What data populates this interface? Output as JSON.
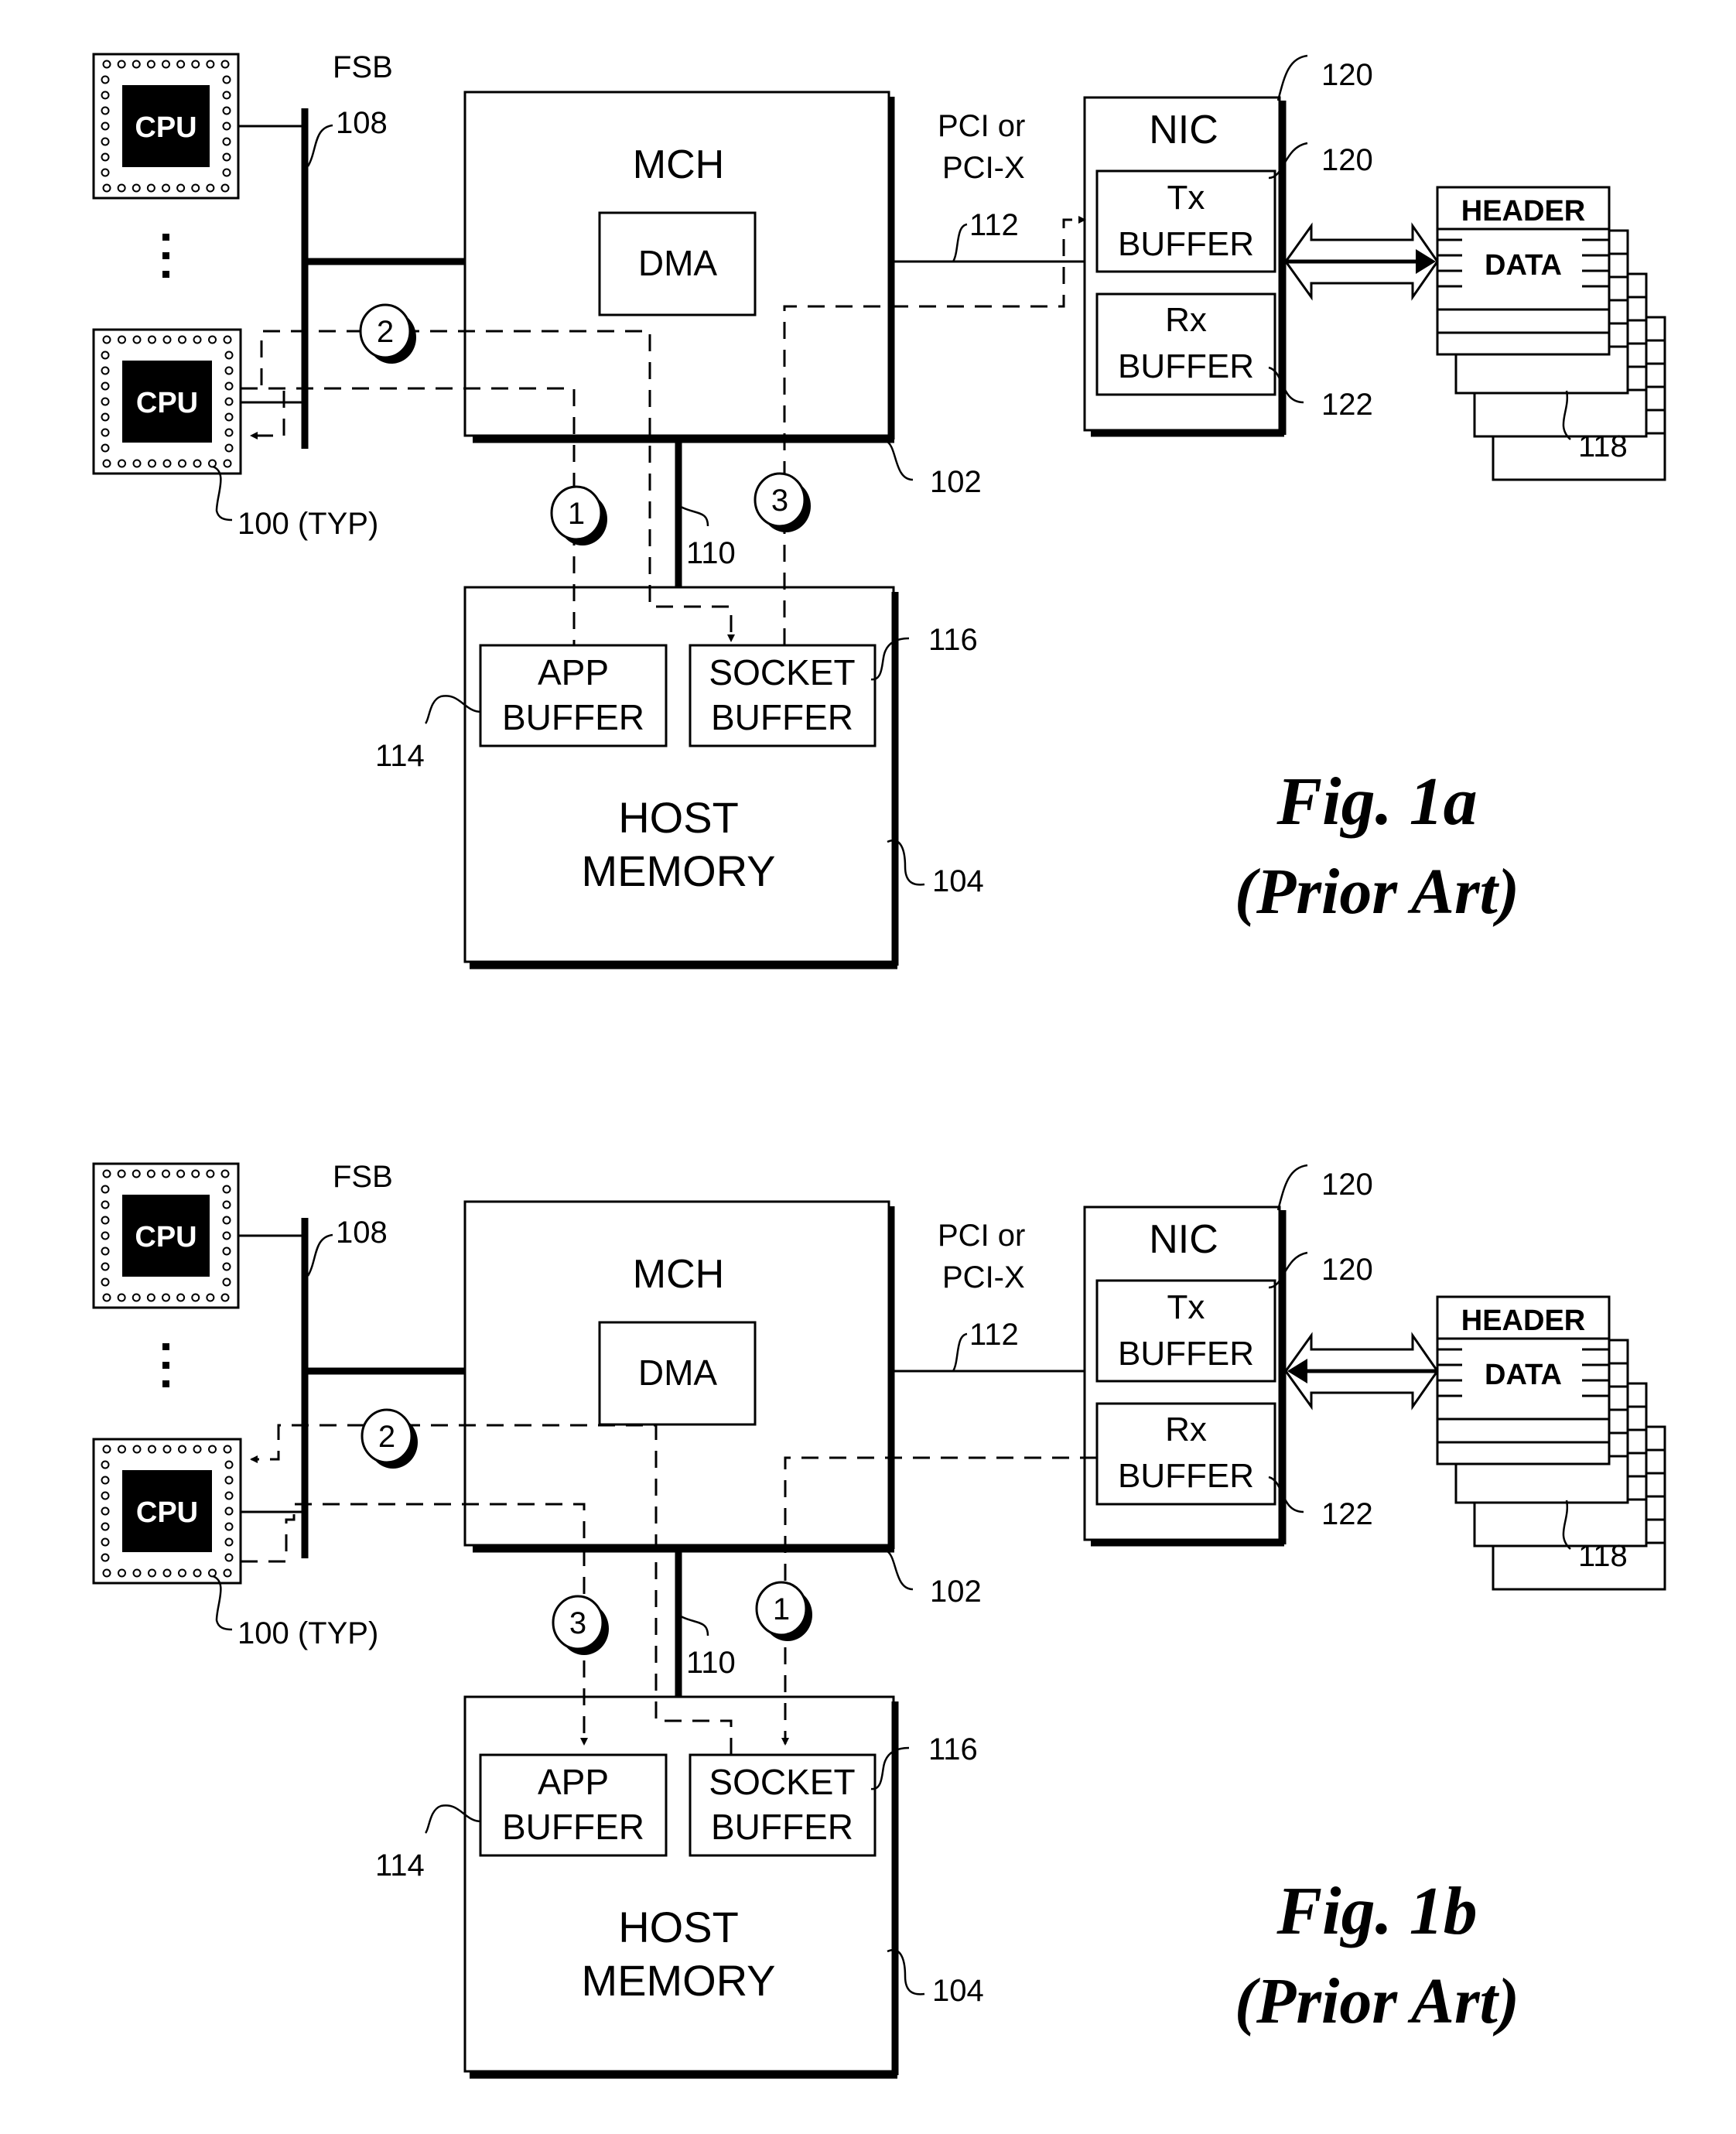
{
  "figures": [
    {
      "id": "fig-1a",
      "caption": "Fig. 1a",
      "subcaption": "(Prior Art)",
      "components": {
        "cpu_label": "CPU",
        "fsb_label": "FSB",
        "mch_label": "MCH",
        "dma_label": "DMA",
        "pci_label_line1": "PCI or",
        "pci_label_line2": "PCI-X",
        "nic_label": "NIC",
        "tx_line1": "Tx",
        "tx_line2": "BUFFER",
        "rx_line1": "Rx",
        "rx_line2": "BUFFER",
        "host_line1": "HOST",
        "host_line2": "MEMORY",
        "app_line1": "APP",
        "app_line2": "BUFFER",
        "socket_line1": "SOCKET",
        "socket_line2": "BUFFER",
        "packet_header": "HEADER",
        "packet_data": "DATA"
      },
      "refs": {
        "fsb": "108",
        "cpu": "100 (TYP)",
        "mch": "102",
        "mem_bus": "110",
        "pci_bus": "112",
        "host_memory": "104",
        "app_buffer": "114",
        "socket_buffer": "116",
        "packets": "118",
        "nic": "120",
        "tx_buffer": "120",
        "rx_buffer": "122"
      },
      "steps": [
        "1",
        "2",
        "3"
      ],
      "flow": "transmit: app buffer -> CPU -> socket buffer -> Tx buffer"
    },
    {
      "id": "fig-1b",
      "caption": "Fig. 1b",
      "subcaption": "(Prior Art)",
      "components": {
        "cpu_label": "CPU",
        "fsb_label": "FSB",
        "mch_label": "MCH",
        "dma_label": "DMA",
        "pci_label_line1": "PCI or",
        "pci_label_line2": "PCI-X",
        "nic_label": "NIC",
        "tx_line1": "Tx",
        "tx_line2": "BUFFER",
        "rx_line1": "Rx",
        "rx_line2": "BUFFER",
        "host_line1": "HOST",
        "host_line2": "MEMORY",
        "app_line1": "APP",
        "app_line2": "BUFFER",
        "socket_line1": "SOCKET",
        "socket_line2": "BUFFER",
        "packet_header": "HEADER",
        "packet_data": "DATA"
      },
      "refs": {
        "fsb": "108",
        "cpu": "100 (TYP)",
        "mch": "102",
        "mem_bus": "110",
        "pci_bus": "112",
        "host_memory": "104",
        "app_buffer": "114",
        "socket_buffer": "116",
        "packets": "118",
        "nic": "120",
        "tx_buffer": "120",
        "rx_buffer": "122"
      },
      "steps": [
        "1",
        "2",
        "3"
      ],
      "flow": "receive: Rx buffer -> socket buffer -> CPU -> app buffer"
    }
  ]
}
